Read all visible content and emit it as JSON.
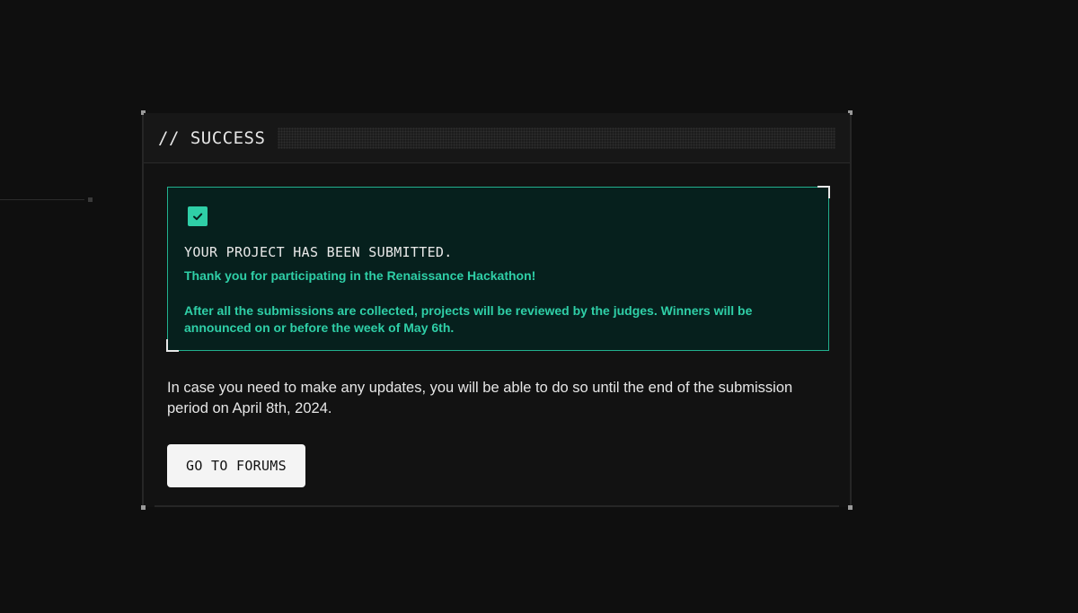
{
  "modal": {
    "header_title": "// SUCCESS",
    "success_box": {
      "icon": "check-icon",
      "title": "YOUR PROJECT HAS BEEN SUBMITTED.",
      "thanks": "Thank you for participating in the Renaissance Hackathon!",
      "detail": "After all the submissions are collected, projects will be reviewed by the judges. Winners will be announced on or before the week of May 6th."
    },
    "info_text": "In case you need to make any updates, you will be able to do so until the end of the submission period on April 8th, 2024.",
    "button_label": "GO TO FORUMS"
  },
  "colors": {
    "background": "#0f0f0f",
    "accent": "#2fcfa7",
    "success_box_bg": "#06201d",
    "button_bg": "#f4f4f4"
  }
}
